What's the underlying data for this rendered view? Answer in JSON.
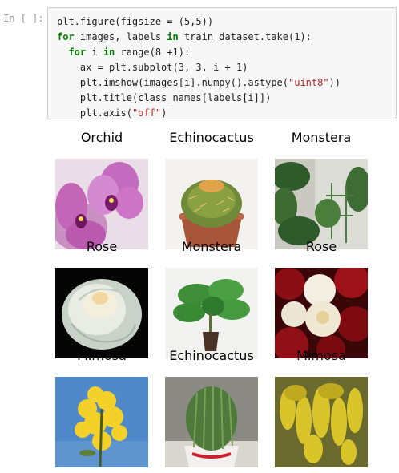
{
  "cell": {
    "prompt": "In [ ]:",
    "code": {
      "line1": "plt.figure(figsize = (5,5))",
      "line2_kw": "for",
      "line2_rest": " images, labels ",
      "line2_in": "in",
      "line2_tail": " train_dataset.take(1):",
      "line3_kw": "for",
      "line3_mid": " i ",
      "line3_in": "in",
      "line3_tail": " range(8 +1):",
      "line4": "ax = plt.subplot(3, 3, i + 1)",
      "line5_a": "plt.imshow(images[i].numpy().astype(",
      "line5_str": "\"uint8\"",
      "line5_b": "))",
      "line6": "plt.title(class_names[labels[i]])",
      "line7_a": "plt.axis(",
      "line7_str": "\"off\"",
      "line7_b": ")"
    }
  },
  "output": {
    "titles": [
      "Orchid",
      "Echinocactus",
      "Monstera",
      "Rose",
      "Monstera",
      "Rose",
      "Mimosa",
      "Echinocactus",
      "Mimosa"
    ],
    "image_subjects": [
      "orchid-photo",
      "cactus-pot-photo",
      "monstera-indoor-photo",
      "white-rose-photo",
      "monstera-pot-photo",
      "rose-bouquet-photo",
      "mimosa-sky-photo",
      "cactus-closeup-photo",
      "mimosa-branches-photo"
    ]
  }
}
